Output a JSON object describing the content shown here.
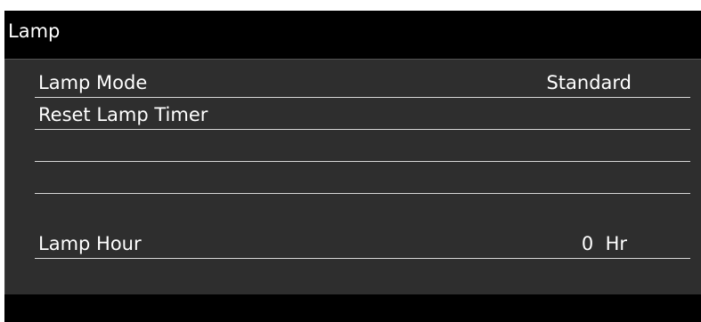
{
  "menu": {
    "title": "Lamp",
    "rows": [
      {
        "label": "Lamp Mode",
        "value": "Standard"
      },
      {
        "label": "Reset Lamp Timer",
        "value": ""
      },
      {
        "label": "",
        "value": ""
      },
      {
        "label": "",
        "value": ""
      },
      {
        "label": "Lamp Hour",
        "value": "0  Hr"
      }
    ]
  },
  "colors": {
    "background": "#000000",
    "panel": "#2e2e2e",
    "text": "#ffffff",
    "divider": "#d8d8d8"
  }
}
